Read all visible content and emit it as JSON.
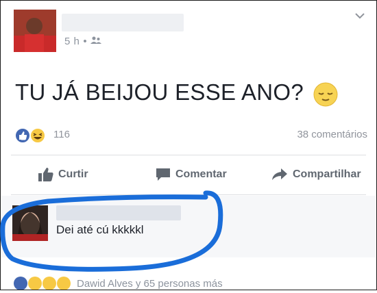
{
  "post": {
    "time": "5 h",
    "audience_icon": "friends-icon",
    "text": "TU JÁ BEIJOU ESSE ANO?",
    "text_emoji": "relieved-face"
  },
  "stats": {
    "reactions_count": "116",
    "comments": "38 comentários"
  },
  "actions": {
    "like_label": "Curtir",
    "comment_label": "Comentar",
    "share_label": "Compartilhar"
  },
  "comment": {
    "text": "Dei até cú kkkkkl"
  },
  "footer": {
    "reactions_text": "Dawid Alves y 65 personas más"
  },
  "colors": {
    "like_blue": "#4267b2",
    "reaction_yellow": "#f7c944",
    "circle_blue": "#1a6dd9",
    "muted_text": "#8d949e"
  }
}
